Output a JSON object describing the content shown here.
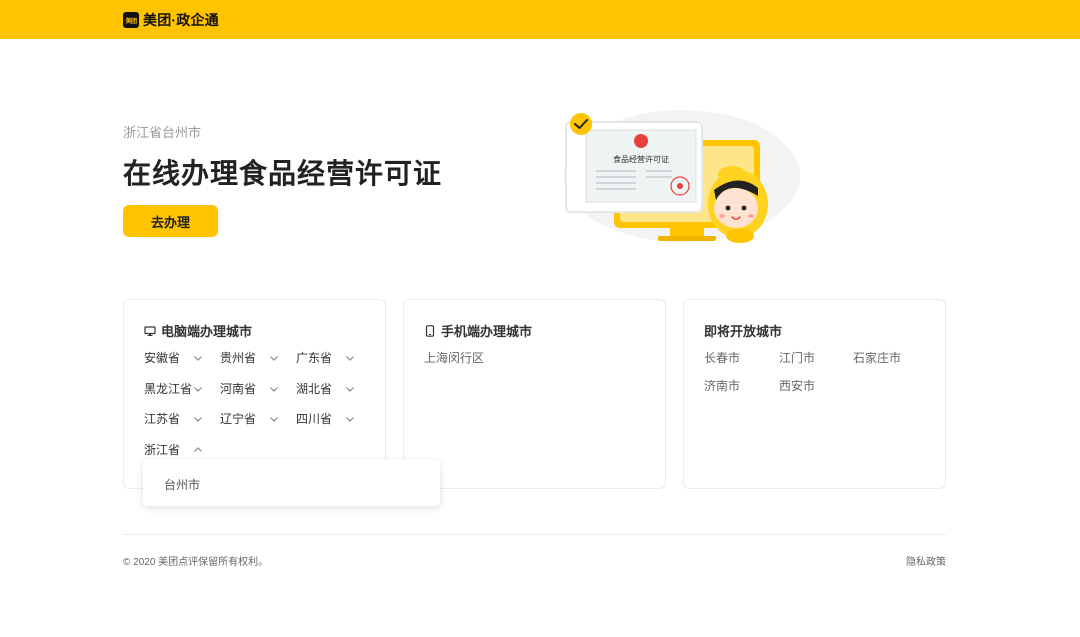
{
  "header": {
    "logo_badge": "美团",
    "brand": "美团·政企通",
    "bg_color": "#FFC300"
  },
  "hero": {
    "region": "浙江省台州市",
    "title": "在线办理食品经营许可证",
    "button_label": "去办理",
    "certificate_title": "食品经营许可证"
  },
  "cards": {
    "pc": {
      "icon": "monitor-icon",
      "title": "电脑端办理城市",
      "provinces": [
        {
          "name": "安徽省",
          "expanded": false
        },
        {
          "name": "贵州省",
          "expanded": false
        },
        {
          "name": "广东省",
          "expanded": false
        },
        {
          "name": "黑龙江省",
          "expanded": false
        },
        {
          "name": "河南省",
          "expanded": false
        },
        {
          "name": "湖北省",
          "expanded": false
        },
        {
          "name": "江苏省",
          "expanded": false
        },
        {
          "name": "辽宁省",
          "expanded": false
        },
        {
          "name": "四川省",
          "expanded": false
        },
        {
          "name": "浙江省",
          "expanded": true
        }
      ],
      "dropdown_items": [
        "台州市"
      ]
    },
    "mobile": {
      "icon": "phone-icon",
      "title": "手机端办理城市",
      "items": [
        "上海闵行区"
      ]
    },
    "upcoming": {
      "title": "即将开放城市",
      "items": [
        "长春市",
        "江门市",
        "石家庄市",
        "济南市",
        "西安市"
      ]
    }
  },
  "footer": {
    "copyright": "© 2020 美团点评保留所有权利。",
    "privacy": "隐私政策"
  }
}
